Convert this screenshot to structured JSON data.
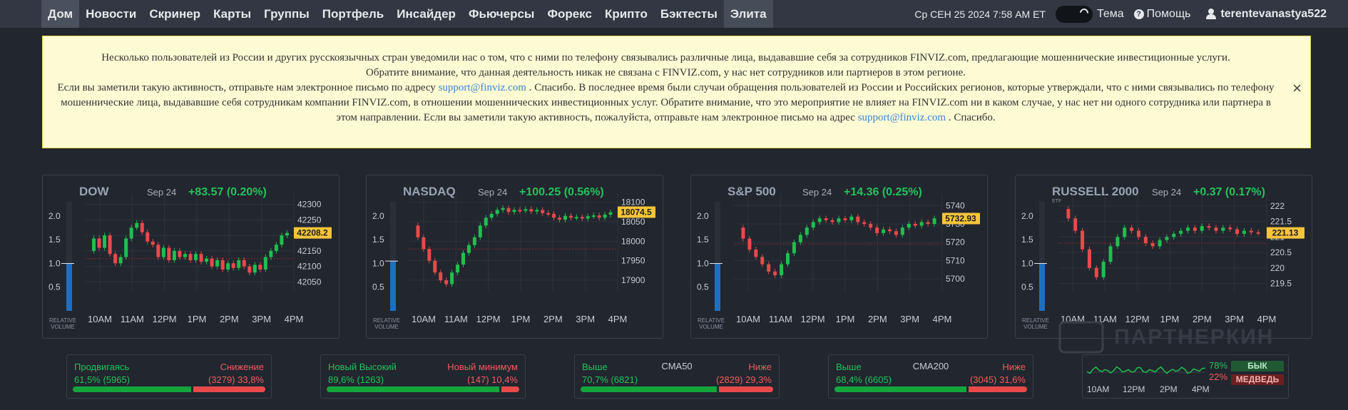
{
  "nav": {
    "tabs": [
      "Дом",
      "Новости",
      "Скринер",
      "Карты",
      "Группы",
      "Портфель",
      "Инсайдер",
      "Фьючерсы",
      "Форекс",
      "Крипто",
      "Бэктесты",
      "Элита"
    ],
    "datetime": "Ср СЕН 25 2024 7:58 AM ET",
    "theme_label": "Тема",
    "help_label": "Помощь",
    "username": "terentevanastya522"
  },
  "notice": {
    "line1": "Несколько пользователей из России и других русскоязычных стран уведомили нас о том, что с ними по телефону связывались различные лица, выдававшие себя за сотрудников FINVIZ.com, предлагающие мошеннические инвестиционные услуги.",
    "line2": "Обратите внимание, что данная деятельность никак не связана с FINVIZ.com, у нас нет сотрудников или партнеров в этом регионе.",
    "line3_pre": "Если вы заметили такую активность, отправьте нам электронное письмо по адресу ",
    "email": "support@finviz.com",
    "line3_post": " . Спасибо. В последнее время были случаи обращения пользователей из России и Российских регионов, которые утверждали, что с ними связывались по телефону мошеннические лица, выдававшие себя сотрудникам компании FINVIZ.com, в отношении мошеннических инвестиционных услуг. Обратите внимание, что это мероприятие не влияет на FINVIZ.com ни в каком случае, у нас нет ни одного сотрудника или партнера в этом направлении. Если вы заметили такую активность, пожалуйста, отправьте нам электронное письмо на адрес ",
    "line3_end": " . Спасибо.",
    "close": "×"
  },
  "chart_data": [
    {
      "type": "line",
      "title": "DOW",
      "date": "Sep 24",
      "change": "+83.57 (0.20%)",
      "last": "42208.2",
      "y_ticks": [
        42050,
        42100,
        42150,
        42200,
        42250,
        42300
      ],
      "ylim": [
        42030,
        42320
      ],
      "vol_ticks": [
        "0.5",
        "1.0",
        "1.5",
        "2.0"
      ],
      "vol_label": [
        "RELATIVE",
        "VOLUME"
      ],
      "vol_level": 1.0,
      "x_ticks": [
        "10AM",
        "11AM",
        "12PM",
        "1PM",
        "2PM",
        "3PM",
        "4PM"
      ],
      "ref": 42125,
      "etf": "",
      "path": [
        42150,
        42190,
        42160,
        42200,
        42140,
        42110,
        42130,
        42190,
        42225,
        42240,
        42210,
        42180,
        42170,
        42130,
        42160,
        42120,
        42150,
        42130,
        42140,
        42120,
        42140,
        42115,
        42125,
        42100,
        42120,
        42090,
        42110,
        42095,
        42120,
        42100,
        42080,
        42105,
        42090,
        42130,
        42150,
        42170,
        42200,
        42208
      ]
    },
    {
      "type": "line",
      "title": "NASDAQ",
      "date": "Sep 24",
      "change": "+100.25 (0.56%)",
      "last": "18074.5",
      "y_ticks": [
        17900,
        17950,
        18000,
        18050,
        18100
      ],
      "ylim": [
        17880,
        18110
      ],
      "vol_ticks": [
        "0.5",
        "1.0",
        "1.5",
        "2.0"
      ],
      "vol_label": [
        "RELATIVE",
        "VOLUME"
      ],
      "vol_level": 1.05,
      "x_ticks": [
        "10AM",
        "11AM",
        "12PM",
        "1PM",
        "2PM",
        "3PM",
        "4PM"
      ],
      "ref": 17980,
      "etf": "",
      "path": [
        18040,
        18010,
        17980,
        17950,
        17920,
        17900,
        17890,
        17920,
        17940,
        17970,
        17990,
        18010,
        18040,
        18060,
        18070,
        18080,
        18085,
        18075,
        18080,
        18078,
        18082,
        18076,
        18080,
        18072,
        18070,
        18060,
        18055,
        18065,
        18060,
        18062,
        18058,
        18064,
        18066,
        18060,
        18068,
        18074
      ]
    },
    {
      "type": "line",
      "title": "S&P 500",
      "date": "Sep 24",
      "change": "+14.36 (0.25%)",
      "last": "5732.93",
      "y_ticks": [
        5700,
        5710,
        5720,
        5730,
        5740
      ],
      "ylim": [
        5695,
        5744
      ],
      "vol_ticks": [
        "0.5",
        "1.0",
        "1.5",
        "2.0"
      ],
      "vol_label": [
        "RELATIVE",
        "VOLUME"
      ],
      "vol_level": 1.0,
      "x_ticks": [
        "10AM",
        "11AM",
        "12PM",
        "1PM",
        "2PM",
        "3PM",
        "4PM"
      ],
      "ref": 5719,
      "etf": "",
      "path": [
        5728,
        5722,
        5716,
        5712,
        5708,
        5704,
        5702,
        5708,
        5714,
        5720,
        5724,
        5728,
        5731,
        5733,
        5732,
        5731,
        5733,
        5732,
        5734,
        5731,
        5730,
        5728,
        5725,
        5727,
        5726,
        5724,
        5728,
        5730,
        5729,
        5731,
        5730,
        5733
      ]
    },
    {
      "type": "line",
      "title": "RUSSELL 2000",
      "date": "Sep 24",
      "change": "+0.37 (0.17%)",
      "last": "221.13",
      "y_ticks": [
        219.5,
        220.0,
        220.5,
        221.0,
        221.5,
        222.0
      ],
      "ylim": [
        219.35,
        222.25
      ],
      "vol_ticks": [
        "0.5",
        "1.0",
        "1.5",
        "2.0"
      ],
      "vol_label": [
        "RELATIVE",
        "VOLUME"
      ],
      "vol_level": 1.0,
      "x_ticks": [
        "10AM",
        "11AM",
        "12PM",
        "1PM",
        "2PM",
        "3PM",
        "4PM"
      ],
      "ref": 220.8,
      "etf": "ETF",
      "path": [
        221.9,
        221.6,
        221.2,
        220.6,
        220.0,
        219.7,
        220.2,
        220.7,
        221.0,
        221.3,
        221.2,
        221.0,
        220.8,
        220.7,
        220.9,
        221.0,
        221.1,
        221.2,
        221.3,
        221.2,
        221.35,
        221.3,
        221.2,
        221.3,
        221.25,
        221.1,
        221.2,
        221.15,
        221.13
      ]
    }
  ],
  "breadth": [
    {
      "left_label": "Продвигаясь",
      "left_value": "61,5% (5965)",
      "mid": "",
      "right_label": "Снижение",
      "right_value": "(3279) 33,8%",
      "green_pct": 61.5
    },
    {
      "left_label": "Новый Высокий",
      "left_value": "89,6% (1263)",
      "mid": "",
      "right_label": "Новый минимум",
      "right_value": "(147) 10,4%",
      "green_pct": 89.6
    },
    {
      "left_label": "Выше",
      "left_value": "70,7% (6821)",
      "mid": "CMA50",
      "right_label": "Ниже",
      "right_value": "(2829) 29,3%",
      "green_pct": 70.7
    },
    {
      "left_label": "Выше",
      "left_value": "68,4% (6605)",
      "mid": "CMA200",
      "right_label": "Ниже",
      "right_value": "(3045) 31,6%",
      "green_pct": 68.4
    }
  ],
  "sentiment": {
    "times": [
      "10AM",
      "12PM",
      "2PM",
      "4PM"
    ],
    "bull_pct": "78%",
    "bear_pct": "22%",
    "bull_label": "БЫК",
    "bear_label": "МЕДВЕДЬ",
    "bull_fraction": 0.78
  },
  "watermark": "ПАРТНЕРКИН",
  "colors": {
    "up": "#1fbf4e",
    "down": "#e84a4a",
    "accent_yellow": "#f7c43a",
    "volume": "#1f6fc0"
  }
}
